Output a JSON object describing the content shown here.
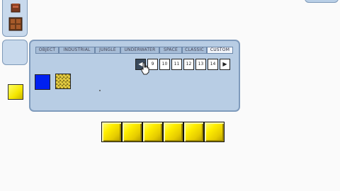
{
  "tabs": [
    {
      "label": "OBJECT",
      "active": false
    },
    {
      "label": "INDUSTRIAL",
      "active": false
    },
    {
      "label": "JUNGLE",
      "active": false
    },
    {
      "label": "UNDERWATER",
      "active": false
    },
    {
      "label": "SPACE",
      "active": false
    },
    {
      "label": "CLASSIC",
      "active": false
    },
    {
      "label": "CUSTOM",
      "active": true
    }
  ],
  "pager": {
    "prev_icon": "◀",
    "pages": [
      "9",
      "10",
      "11",
      "12",
      "13",
      "14"
    ],
    "next_icon": "▶"
  },
  "palette": {
    "swatches": [
      {
        "name": "blue-block",
        "color": "#0020f0"
      },
      {
        "name": "gold-block",
        "color": "#8a7a20"
      }
    ]
  },
  "level": {
    "block_count": 6,
    "block_color": "#ffee00"
  }
}
